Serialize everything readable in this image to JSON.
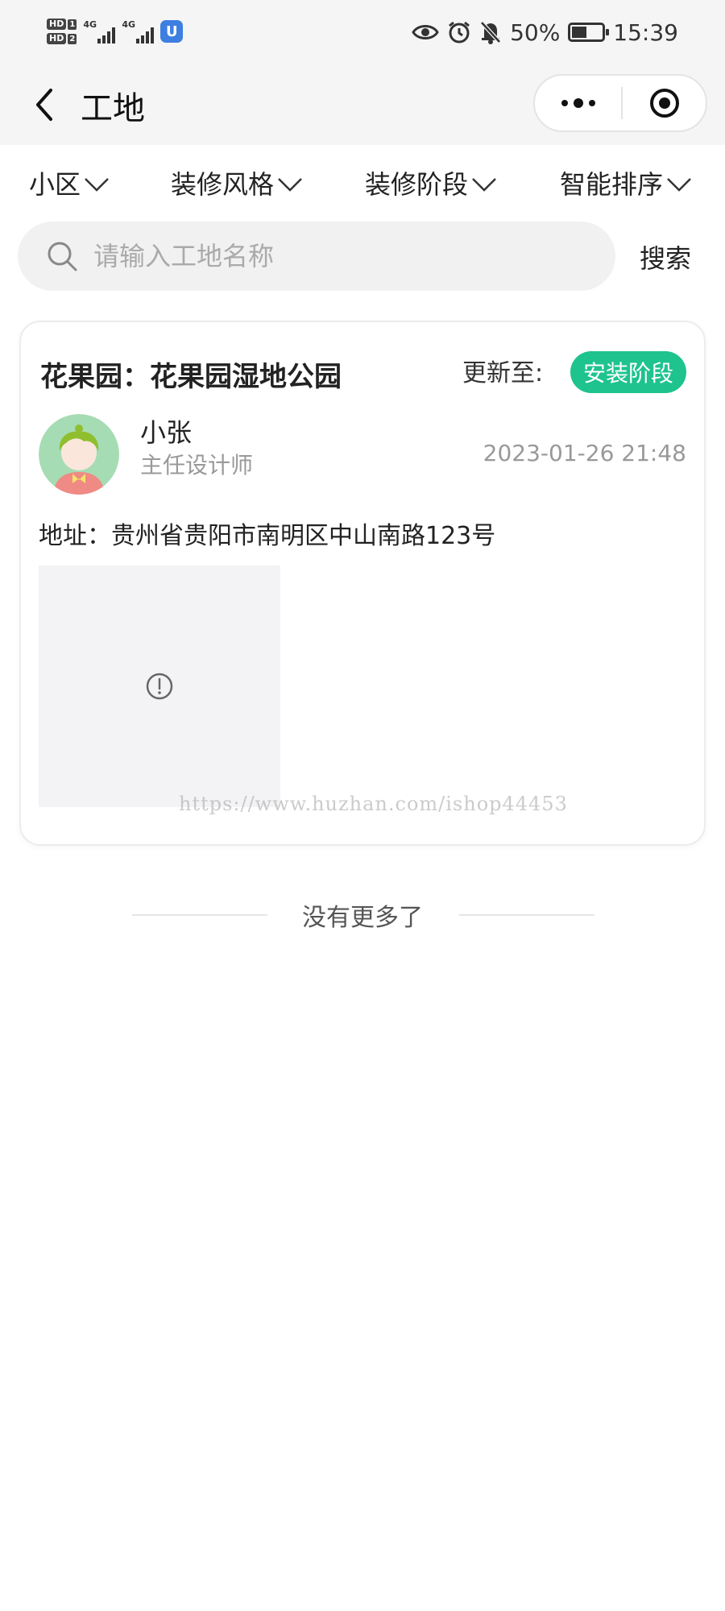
{
  "status_bar": {
    "sim1": "HD",
    "sim1_num": "1",
    "sim2": "HD",
    "sim2_num": "2",
    "net1": "4G",
    "net2": "4G",
    "app_icon": "U",
    "battery_percent": "50%",
    "battery_level": 0.5,
    "time": "15:39",
    "icons": [
      "eye-icon",
      "alarm-icon",
      "mute-bell-icon",
      "battery-charging-icon"
    ]
  },
  "nav": {
    "title": "工地",
    "back_icon": "chevron-left-icon",
    "more_icon": "more-dots-icon",
    "close_icon": "target-close-icon"
  },
  "filters": [
    {
      "label": "小区"
    },
    {
      "label": "装修风格"
    },
    {
      "label": "装修阶段"
    },
    {
      "label": "智能排序"
    }
  ],
  "search": {
    "placeholder": "请输入工地名称",
    "value": "",
    "button_label": "搜索"
  },
  "card": {
    "title": "花果园：花果园湿地公园",
    "update_label": "更新至:",
    "stage": "安装阶段",
    "user_name": "小张",
    "user_role": "主任设计师",
    "time": "2023-01-26 21:48",
    "address": "地址：贵州省贵阳市南明区中山南路123号",
    "image_state": "broken-image-icon",
    "watermark": "https://www.huzhan.com/ishop44453"
  },
  "footer": {
    "no_more": "没有更多了"
  },
  "colors": {
    "accent_green": "#1ec38d",
    "bar_bg": "#f5f5f5",
    "placeholder": "#aaaaaa"
  }
}
